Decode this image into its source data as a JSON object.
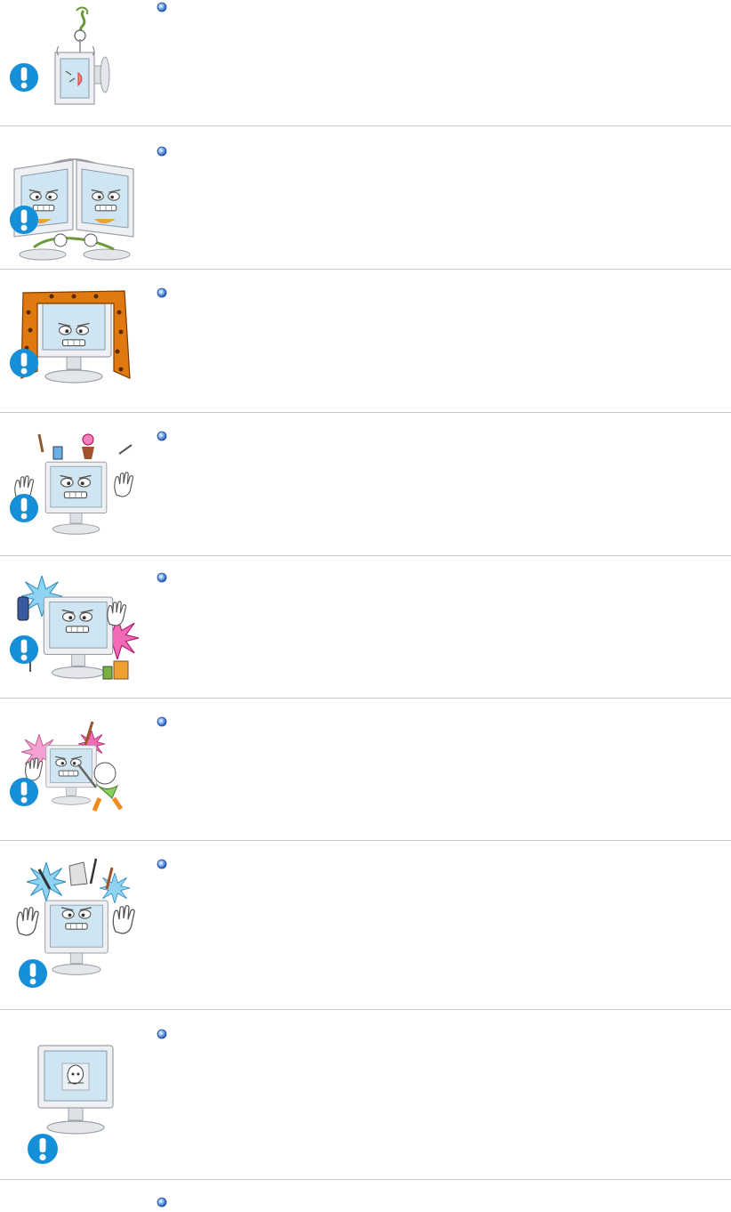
{
  "sections": [
    {
      "illustration_icon": "monitor-lifted-by-cord-icon",
      "warning_icon": "exclamation-warning-icon",
      "bullet_icon": "blue-bullet-icon"
    },
    {
      "illustration_icon": "monitor-tilt-cable-strain-icon",
      "warning_icon": "exclamation-warning-icon",
      "bullet_icon": "blue-bullet-icon"
    },
    {
      "illustration_icon": "monitor-covered-by-cloth-icon",
      "warning_icon": "exclamation-warning-icon",
      "bullet_icon": "blue-bullet-icon"
    },
    {
      "illustration_icon": "objects-on-monitor-icon",
      "warning_icon": "exclamation-warning-icon",
      "bullet_icon": "blue-bullet-icon"
    },
    {
      "illustration_icon": "flammable-spray-near-monitor-icon",
      "warning_icon": "exclamation-warning-icon",
      "bullet_icon": "blue-bullet-icon"
    },
    {
      "illustration_icon": "sharp-objects-into-monitor-icon",
      "warning_icon": "exclamation-warning-icon",
      "bullet_icon": "blue-bullet-icon"
    },
    {
      "illustration_icon": "metal-objects-into-vents-icon",
      "warning_icon": "exclamation-warning-icon",
      "bullet_icon": "blue-bullet-icon"
    },
    {
      "illustration_icon": "static-image-burn-in-icon",
      "warning_icon": "exclamation-warning-icon",
      "bullet_icon": "blue-bullet-icon"
    },
    {
      "illustration_icon": "",
      "warning_icon": "",
      "bullet_icon": "blue-bullet-icon"
    }
  ],
  "colors": {
    "warning_blue": "#1590d8",
    "bullet_blue": "#2f6fd0",
    "divider": "#c8c8c8",
    "monitor_gray": "#d9dbe0",
    "screen_blue": "#cfe6f2",
    "cloth_orange": "#e07a10",
    "spark_blue": "#8fd3f2",
    "spark_pink": "#f06ab6"
  }
}
